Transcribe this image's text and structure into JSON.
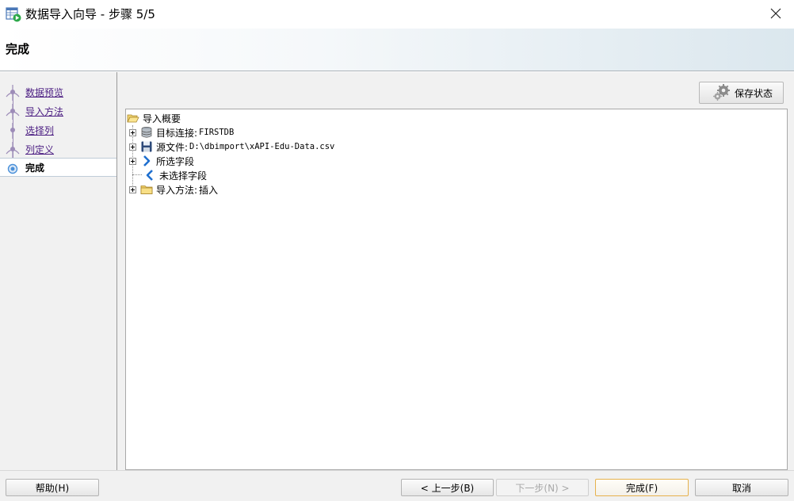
{
  "window": {
    "title": "数据导入向导 - 步骤 5/5",
    "icon": "table-import-icon"
  },
  "header": {
    "title": "完成"
  },
  "steps": [
    {
      "label": "数据预览",
      "state": "visited"
    },
    {
      "label": "导入方法",
      "state": "visited"
    },
    {
      "label": "选择列",
      "state": "visited"
    },
    {
      "label": "列定义",
      "state": "visited"
    },
    {
      "label": "完成",
      "state": "active"
    }
  ],
  "toolbar": {
    "save_state_label": "保存状态"
  },
  "tree": {
    "root": {
      "label": "导入概要",
      "icon": "folder-open-icon"
    },
    "items": [
      {
        "name": "目标连接:",
        "value": "FIRSTDB",
        "icon": "database-icon",
        "expandable": true
      },
      {
        "name": "源文件:",
        "value": "D:\\dbimport\\xAPI-Edu-Data.csv",
        "icon": "save-disk-icon",
        "expandable": true
      },
      {
        "name": "所选字段",
        "value": "",
        "icon": "chevron-right-icon",
        "expandable": true
      },
      {
        "name": "未选择字段",
        "value": "",
        "icon": "chevron-left-icon",
        "expandable": false
      },
      {
        "name": "导入方法:",
        "value": "插入",
        "icon": "folder-icon",
        "expandable": true
      }
    ]
  },
  "buttons": {
    "help": "帮助(H)",
    "back": "< 上一步(B)",
    "next": "下一步(N) >",
    "finish": "完成(F)",
    "cancel": "取消"
  },
  "colors": {
    "link_visited": "#4b1d82",
    "step_marker": "#9d8cb8",
    "active_step_marker": "#4a90d9",
    "finish_border": "#e6b24e"
  }
}
